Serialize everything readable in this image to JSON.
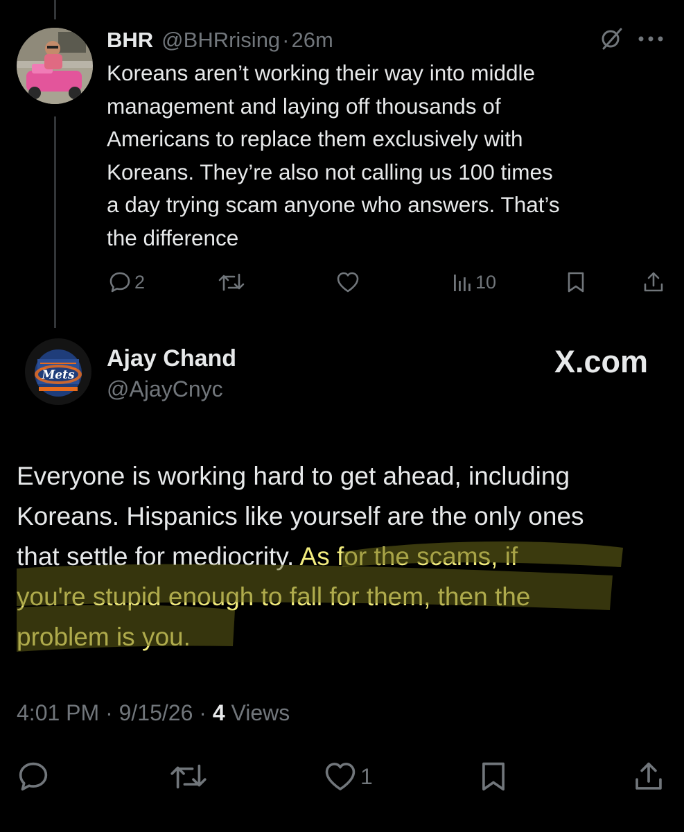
{
  "parent_tweet": {
    "name": "BHR",
    "handle": "@BHRrising",
    "separator": "·",
    "time": "26m",
    "avatar_icon": "avatar-child-pink-jeep",
    "lines": [
      "Koreans aren’t working their way into middle",
      "management and laying off thousands of",
      "Americans to replace them exclusively with",
      "Koreans. They’re also not calling us 100 times",
      "a day trying scam anyone who answers. That’s",
      "the difference"
    ],
    "actions": {
      "reply_count": "2",
      "repost_count": "",
      "like_count": "",
      "views_count": "10"
    },
    "icons": [
      "grok-slash-icon",
      "more-icon",
      "reply-icon",
      "repost-icon",
      "like-icon",
      "views-icon",
      "bookmark-icon",
      "share-icon"
    ]
  },
  "main_tweet": {
    "name": "Ajay Chand",
    "handle": "@AjayCnyc",
    "avatar_icon": "avatar-mets-logo",
    "brand": "X.com",
    "lines": [
      {
        "plain": "Everyone is working hard to get ahead, including",
        "highlight": ""
      },
      {
        "plain": "Koreans. Hispanics like yourself are the only ones",
        "highlight": ""
      },
      {
        "plain": "that settle for mediocrity. ",
        "highlight": "As for the scams, if"
      },
      {
        "plain": "",
        "highlight": "you're stupid enough to fall for them, then the"
      },
      {
        "plain": "",
        "highlight": "problem is you."
      }
    ],
    "highlight_color": "#f2ec7e",
    "meta": {
      "time": "4:01 PM",
      "separator": "·",
      "date": "9/15/26",
      "views_count": "4",
      "views_label": "Views"
    },
    "actions": {
      "reply_count": "",
      "repost_count": "",
      "like_count": "1"
    }
  },
  "colors": {
    "background": "#000000",
    "text": "#e7e9ea",
    "secondary": "#71767b",
    "thread_line": "#333639"
  }
}
